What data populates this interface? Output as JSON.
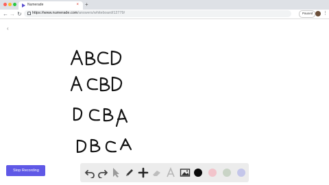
{
  "browser": {
    "tab_title": "Numerade",
    "tab_close": "×",
    "new_tab": "+",
    "url_host": "https://www.numerade.com",
    "url_path": "/answers/whiteboard/12779/",
    "profile_status": "Paused",
    "colors": {
      "tab_close": "#d93025",
      "favicon": "#5a4fcf"
    }
  },
  "whiteboard": {
    "back_icon": "chevron-left-icon",
    "handwritten_lines": [
      "ABCD",
      "ACBD",
      "DCBA",
      "DBCA"
    ]
  },
  "recording": {
    "stop_label": "Stop Recording",
    "button_color": "#5f58e6"
  },
  "toolbar": {
    "tools": [
      "undo-icon",
      "redo-icon",
      "pointer-icon",
      "pen-icon",
      "add-icon",
      "eraser-icon",
      "text-icon",
      "image-icon"
    ],
    "colors": [
      "#0a0a0a",
      "#f2c4cb",
      "#c9d4c6",
      "#c4c6ea"
    ]
  }
}
